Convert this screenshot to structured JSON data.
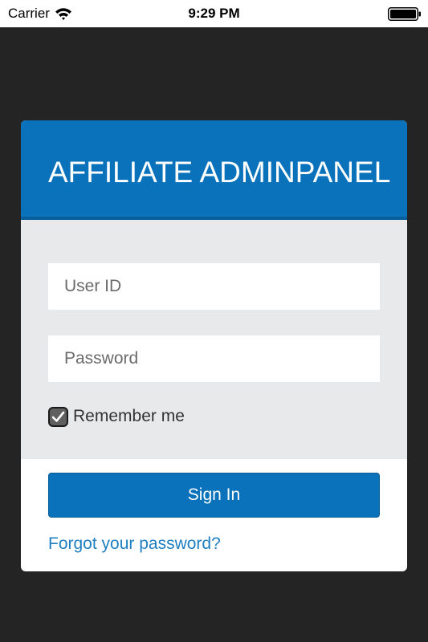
{
  "status_bar": {
    "carrier": "Carrier",
    "time": "9:29 PM",
    "wifi_icon": "wifi-icon",
    "battery_icon": "battery-icon"
  },
  "login_card": {
    "title": "AFFILIATE ADMINPANEL",
    "user_id": {
      "value": "",
      "placeholder": "User ID"
    },
    "password": {
      "value": "",
      "placeholder": "Password"
    },
    "remember_me": {
      "label": "Remember me",
      "checked": true
    },
    "sign_in_label": "Sign In",
    "forgot_password_label": "Forgot your password?"
  },
  "colors": {
    "background": "#242424",
    "brand_blue": "#0a72ba",
    "form_gray": "#e8e9eb",
    "link_blue": "#1f7fc0"
  }
}
